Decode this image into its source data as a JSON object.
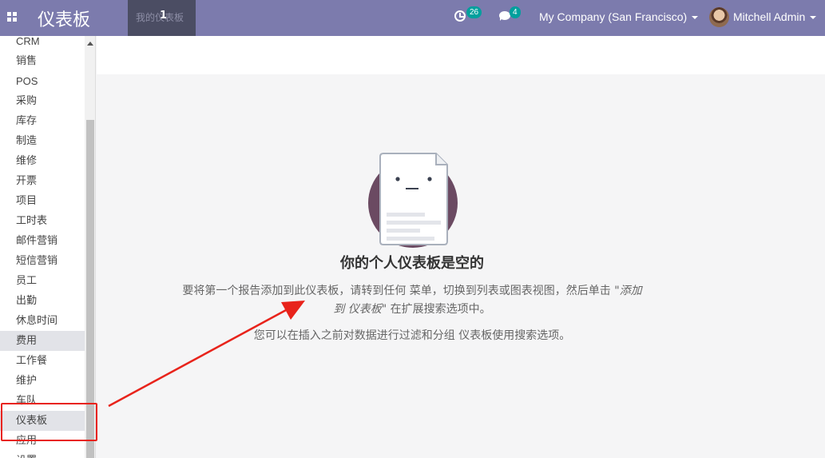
{
  "navbar": {
    "app_title": "仪表板",
    "tab_label": "我的仪表板",
    "tab_cursor_text": "1",
    "activity_count": "26",
    "message_count": "4",
    "company": "My Company (San Francisco)",
    "user": "Mitchell Admin"
  },
  "sidebar": {
    "items": [
      {
        "label": "CRM"
      },
      {
        "label": "销售"
      },
      {
        "label": "POS"
      },
      {
        "label": "采购"
      },
      {
        "label": "库存"
      },
      {
        "label": "制造"
      },
      {
        "label": "维修"
      },
      {
        "label": "开票"
      },
      {
        "label": "项目"
      },
      {
        "label": "工时表"
      },
      {
        "label": "邮件营销"
      },
      {
        "label": "短信营销"
      },
      {
        "label": "员工"
      },
      {
        "label": "出勤"
      },
      {
        "label": "休息时间"
      },
      {
        "label": "费用"
      },
      {
        "label": "工作餐"
      },
      {
        "label": "维护"
      },
      {
        "label": "车队"
      },
      {
        "label": "仪表板"
      },
      {
        "label": "应用"
      },
      {
        "label": "设置"
      }
    ]
  },
  "empty_state": {
    "title": "你的个人仪表板是空的",
    "hint_line1_before": "要将第一个报告添加到此仪表板，请转到任何 菜单，切换到列表或图表视图，然后单击 \"",
    "hint_line1_em": "添加",
    "hint_line2_em": "到 仪表板",
    "hint_line2_after": "\" 在扩展搜索选项中。",
    "hint2": "您可以在插入之前对数据进行过滤和分组 仪表板使用搜索选项。"
  },
  "colors": {
    "navbar": "#7c7bad",
    "badge": "#00a09d",
    "annotation": "#e8231b",
    "illustration_circle": "#6b4a62"
  },
  "icons": [
    "apps-grid-icon",
    "activity-clock-icon",
    "chat-bubble-icon",
    "caret-down-icon",
    "empty-document-icon"
  ]
}
